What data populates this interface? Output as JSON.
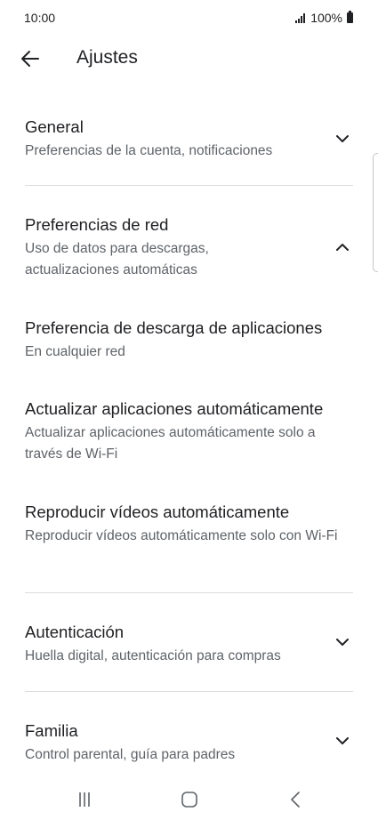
{
  "status_bar": {
    "time": "10:00",
    "battery": "100%"
  },
  "app_bar": {
    "title": "Ajustes",
    "back_icon": "arrow-back-icon"
  },
  "settings": [
    {
      "title": "General",
      "subtitle": "Preferencias de la cuenta, notificaciones",
      "state": "collapsed"
    },
    {
      "title": "Preferencias de red",
      "subtitle": "Uso de datos para descargas, actualizaciones automáticas",
      "state": "expanded"
    },
    {
      "title": "Preferencia de descarga de aplicaciones",
      "subtitle": "En cualquier red"
    },
    {
      "title": "Actualizar aplicaciones automáticamente",
      "subtitle": "Actualizar aplicaciones automáticamente solo a través de Wi-Fi"
    },
    {
      "title": "Reproducir vídeos automáticamente",
      "subtitle": "Reproducir vídeos automáticamente solo con Wi-Fi"
    },
    {
      "title": "Autenticación",
      "subtitle": "Huella digital, autenticación para compras",
      "state": "collapsed"
    },
    {
      "title": "Familia",
      "subtitle": "Control parental, guía para padres",
      "state": "collapsed"
    }
  ],
  "nav_bar": {
    "recents_icon": "recents-icon",
    "home_icon": "home-icon",
    "back_icon": "nav-back-icon"
  },
  "colors": {
    "text_primary": "#202124",
    "text_secondary": "#5f6368",
    "divider": "#dadce0"
  }
}
